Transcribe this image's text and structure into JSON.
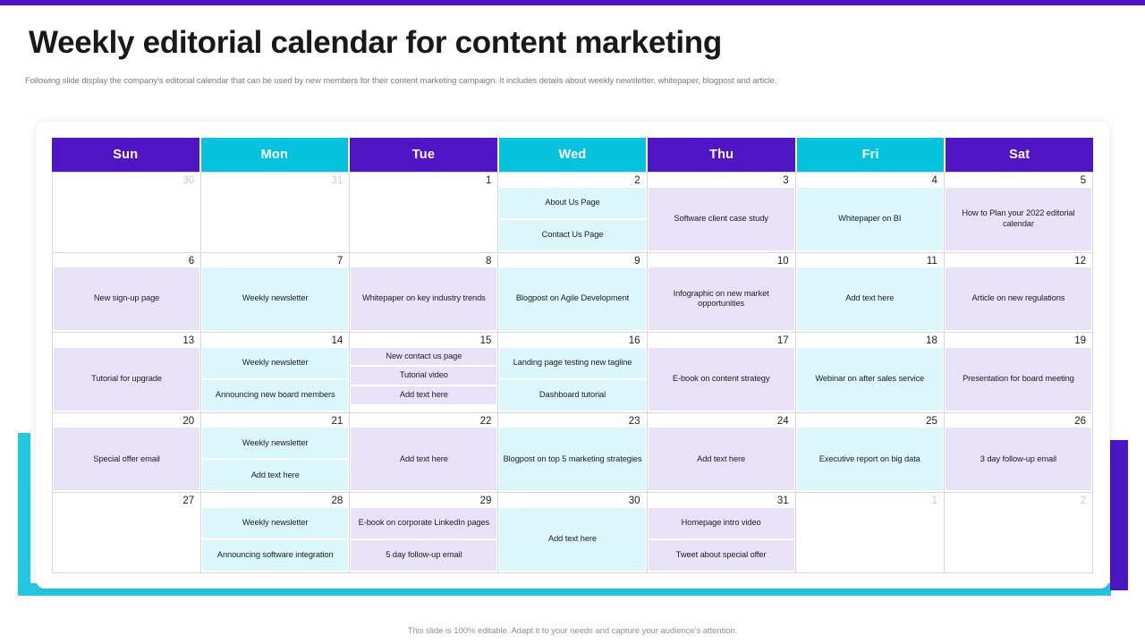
{
  "slide": {
    "title": "Weekly editorial calendar for content marketing",
    "subtitle": "Following slide display the company's editorial calendar that can be used by new members for their content marketing campaign. It includes details about weekly newsletter, whitepaper, blogpost and article.",
    "footer_note": "This slide is 100% editable. Adapt it to your needs and capture your audience's attention."
  },
  "colors": {
    "purple": "#5016c6",
    "cyan": "#05c3de",
    "top_bar": "#5213c8",
    "accent_cyan": "#22c8e0",
    "accent_purple": "#4b16c4",
    "event_cyan": "#dcf7fb",
    "event_purple": "#e8e1f8"
  },
  "calendar": {
    "day_headers": [
      {
        "label": "Sun",
        "tone": "purple"
      },
      {
        "label": "Mon",
        "tone": "cyan"
      },
      {
        "label": "Tue",
        "tone": "purple"
      },
      {
        "label": "Wed",
        "tone": "cyan"
      },
      {
        "label": "Thu",
        "tone": "purple"
      },
      {
        "label": "Fri",
        "tone": "cyan"
      },
      {
        "label": "Sat",
        "tone": "purple"
      }
    ],
    "weeks": [
      [
        {
          "date": "30",
          "muted": true,
          "events": []
        },
        {
          "date": "31",
          "muted": true,
          "events": []
        },
        {
          "date": "1",
          "muted": false,
          "events": []
        },
        {
          "date": "2",
          "muted": false,
          "events": [
            {
              "text": "About Us Page",
              "tone": "cyan"
            },
            {
              "text": "Contact Us Page",
              "tone": "cyan"
            }
          ]
        },
        {
          "date": "3",
          "muted": false,
          "events": [
            {
              "text": "Software client case study",
              "tone": "purple"
            }
          ]
        },
        {
          "date": "4",
          "muted": false,
          "events": [
            {
              "text": "Whitepaper on BI",
              "tone": "cyan"
            }
          ]
        },
        {
          "date": "5",
          "muted": false,
          "events": [
            {
              "text": "How to Plan  your 2022 editorial calendar",
              "tone": "purple"
            }
          ]
        }
      ],
      [
        {
          "date": "6",
          "muted": false,
          "events": [
            {
              "text": "New sign-up page",
              "tone": "purple"
            }
          ]
        },
        {
          "date": "7",
          "muted": false,
          "events": [
            {
              "text": "Weekly newsletter",
              "tone": "cyan"
            }
          ]
        },
        {
          "date": "8",
          "muted": false,
          "events": [
            {
              "text": "Whitepaper on key industry trends",
              "tone": "purple"
            }
          ]
        },
        {
          "date": "9",
          "muted": false,
          "events": [
            {
              "text": "Blogpost on Agile Development",
              "tone": "cyan"
            }
          ]
        },
        {
          "date": "10",
          "muted": false,
          "events": [
            {
              "text": "Infographic on new market opportunities",
              "tone": "purple"
            }
          ]
        },
        {
          "date": "11",
          "muted": false,
          "events": [
            {
              "text": "Add text here",
              "tone": "cyan"
            }
          ]
        },
        {
          "date": "12",
          "muted": false,
          "events": [
            {
              "text": "Article on new regulations",
              "tone": "purple"
            }
          ]
        }
      ],
      [
        {
          "date": "13",
          "muted": false,
          "events": [
            {
              "text": "Tutorial  for upgrade",
              "tone": "purple"
            }
          ]
        },
        {
          "date": "14",
          "muted": false,
          "events": [
            {
              "text": "Weekly newsletter",
              "tone": "cyan"
            },
            {
              "text": "Announcing new board members",
              "tone": "cyan"
            }
          ]
        },
        {
          "date": "15",
          "muted": false,
          "events": [
            {
              "text": "New contact us page",
              "tone": "purple"
            },
            {
              "text": "Tutorial video",
              "tone": "purple"
            },
            {
              "text": "Add text here",
              "tone": "purple"
            }
          ]
        },
        {
          "date": "16",
          "muted": false,
          "events": [
            {
              "text": "Landing page testing new tagline",
              "tone": "cyan"
            },
            {
              "text": "Dashboard tutorial",
              "tone": "cyan"
            }
          ]
        },
        {
          "date": "17",
          "muted": false,
          "events": [
            {
              "text": "E-book on content strategy",
              "tone": "purple"
            }
          ]
        },
        {
          "date": "18",
          "muted": false,
          "events": [
            {
              "text": "Webinar on after sales service",
              "tone": "cyan"
            }
          ]
        },
        {
          "date": "19",
          "muted": false,
          "events": [
            {
              "text": "Presentation for board meeting",
              "tone": "purple"
            }
          ]
        }
      ],
      [
        {
          "date": "20",
          "muted": false,
          "events": [
            {
              "text": "Special offer email",
              "tone": "purple"
            }
          ]
        },
        {
          "date": "21",
          "muted": false,
          "events": [
            {
              "text": "Weekly newsletter",
              "tone": "cyan"
            },
            {
              "text": "Add text here",
              "tone": "cyan"
            }
          ]
        },
        {
          "date": "22",
          "muted": false,
          "events": [
            {
              "text": "Add text here",
              "tone": "purple"
            }
          ]
        },
        {
          "date": "23",
          "muted": false,
          "events": [
            {
              "text": "Blogpost on top 5 marketing strategies",
              "tone": "cyan"
            }
          ]
        },
        {
          "date": "24",
          "muted": false,
          "events": [
            {
              "text": "Add text here",
              "tone": "purple"
            }
          ]
        },
        {
          "date": "25",
          "muted": false,
          "events": [
            {
              "text": "Executive report on big data",
              "tone": "cyan"
            }
          ]
        },
        {
          "date": "26",
          "muted": false,
          "events": [
            {
              "text": "3 day follow-up email",
              "tone": "purple"
            }
          ]
        }
      ],
      [
        {
          "date": "27",
          "muted": false,
          "events": []
        },
        {
          "date": "28",
          "muted": false,
          "events": [
            {
              "text": "Weekly newsletter",
              "tone": "cyan"
            },
            {
              "text": "Announcing software integration",
              "tone": "cyan"
            }
          ]
        },
        {
          "date": "29",
          "muted": false,
          "events": [
            {
              "text": "E-book on corporate LinkedIn  pages",
              "tone": "purple"
            },
            {
              "text": "5 day follow-up email",
              "tone": "purple"
            }
          ]
        },
        {
          "date": "30",
          "muted": false,
          "events": [
            {
              "text": "Add text here",
              "tone": "cyan"
            }
          ]
        },
        {
          "date": "31",
          "muted": false,
          "events": [
            {
              "text": "Homepage  intro video",
              "tone": "purple"
            },
            {
              "text": "Tweet about special offer",
              "tone": "purple"
            }
          ]
        },
        {
          "date": "1",
          "muted": true,
          "events": []
        },
        {
          "date": "2",
          "muted": true,
          "events": []
        }
      ]
    ]
  }
}
